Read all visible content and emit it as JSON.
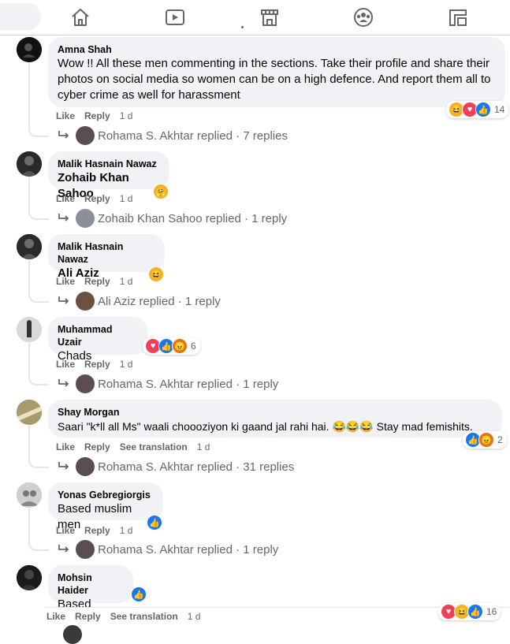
{
  "nav": {
    "icons": [
      "home-icon",
      "video-icon",
      "marketplace-icon",
      "groups-icon",
      "gaming-icon"
    ]
  },
  "comments": [
    {
      "author": "Amna Shah",
      "text": "Wow !! All these men commenting in the sections. Take their profile and share their photos on social media so women can be on a high defence. And report them all to cyber crime as well for harassment",
      "like": "Like",
      "reply": "Reply",
      "time": "1 d",
      "reactions": [
        "haha",
        "love",
        "like"
      ],
      "reaction_count": "14",
      "replies_text": "Rohama S. Akhtar replied · 7 replies"
    },
    {
      "author": "Malik Hasnain Nawaz",
      "text": "Zohaib Khan Sahoo",
      "like": "Like",
      "reply": "Reply",
      "time": "1 d",
      "reactions": [
        "care"
      ],
      "reaction_count": "",
      "replies_text": "Zohaib Khan Sahoo replied · 1 reply"
    },
    {
      "author": "Malik Hasnain Nawaz",
      "text": "Ali Aziz",
      "like": "Like",
      "reply": "Reply",
      "time": "1 d",
      "reactions": [
        "haha"
      ],
      "reaction_count": "",
      "replies_text": "Ali Aziz replied · 1 reply"
    },
    {
      "author": "Muhammad Uzair",
      "text": "Chads",
      "like": "Like",
      "reply": "Reply",
      "time": "1 d",
      "reactions": [
        "love",
        "like",
        "angry"
      ],
      "reaction_count": "6",
      "replies_text": "Rohama S. Akhtar replied · 1 reply"
    },
    {
      "author": "Shay Morgan",
      "text": "Saari \"k*ll all Ms\" waali choooziyon ki gaand jal rahi hai. 😂😂😂 Stay mad femishits.",
      "like": "Like",
      "reply": "Reply",
      "see_translation": "See translation",
      "time": "1 d",
      "reactions": [
        "like",
        "angry"
      ],
      "reaction_count": "2",
      "replies_text": "Rohama S. Akhtar replied · 31 replies"
    },
    {
      "author": "Yonas Gebregiorgis",
      "text": "Based muslim men",
      "like": "Like",
      "reply": "Reply",
      "time": "1 d",
      "reactions": [
        "like"
      ],
      "reaction_count": "",
      "replies_text": "Rohama S. Akhtar replied · 1 reply"
    },
    {
      "author": "Mohsin Haider",
      "text": "Based",
      "like": "Like",
      "reply": "Reply",
      "see_translation": "See translation",
      "time": "1 d",
      "reactions": [
        "like"
      ],
      "reaction_count": "",
      "reactions_footer": [
        "love",
        "haha",
        "like"
      ],
      "reaction_count_footer": "16"
    }
  ],
  "colors": {
    "bubble": "#f0f2f5",
    "meta": "#65676b",
    "like": "#1877f2"
  }
}
